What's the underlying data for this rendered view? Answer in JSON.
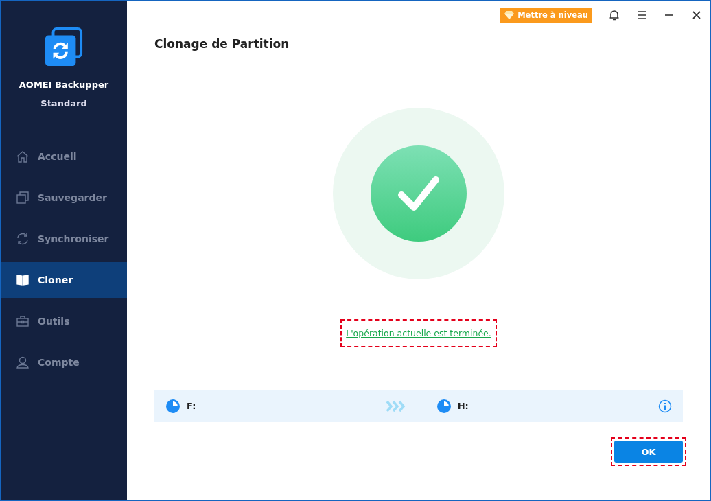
{
  "app": {
    "name": "AOMEI Backupper",
    "edition": "Standard"
  },
  "nav": [
    {
      "label": "Accueil",
      "selected": false
    },
    {
      "label": "Sauvegarder",
      "selected": false
    },
    {
      "label": "Synchroniser",
      "selected": false
    },
    {
      "label": "Cloner",
      "selected": true
    },
    {
      "label": "Outils",
      "selected": false
    },
    {
      "label": "Compte",
      "selected": false
    }
  ],
  "upgrade_button": "Mettre à niveau",
  "title": "Clonage de Partition",
  "status_link": "L'opération actuelle est terminée.",
  "partitions": {
    "source": "F:",
    "target": "H:"
  },
  "ok_button": "OK"
}
